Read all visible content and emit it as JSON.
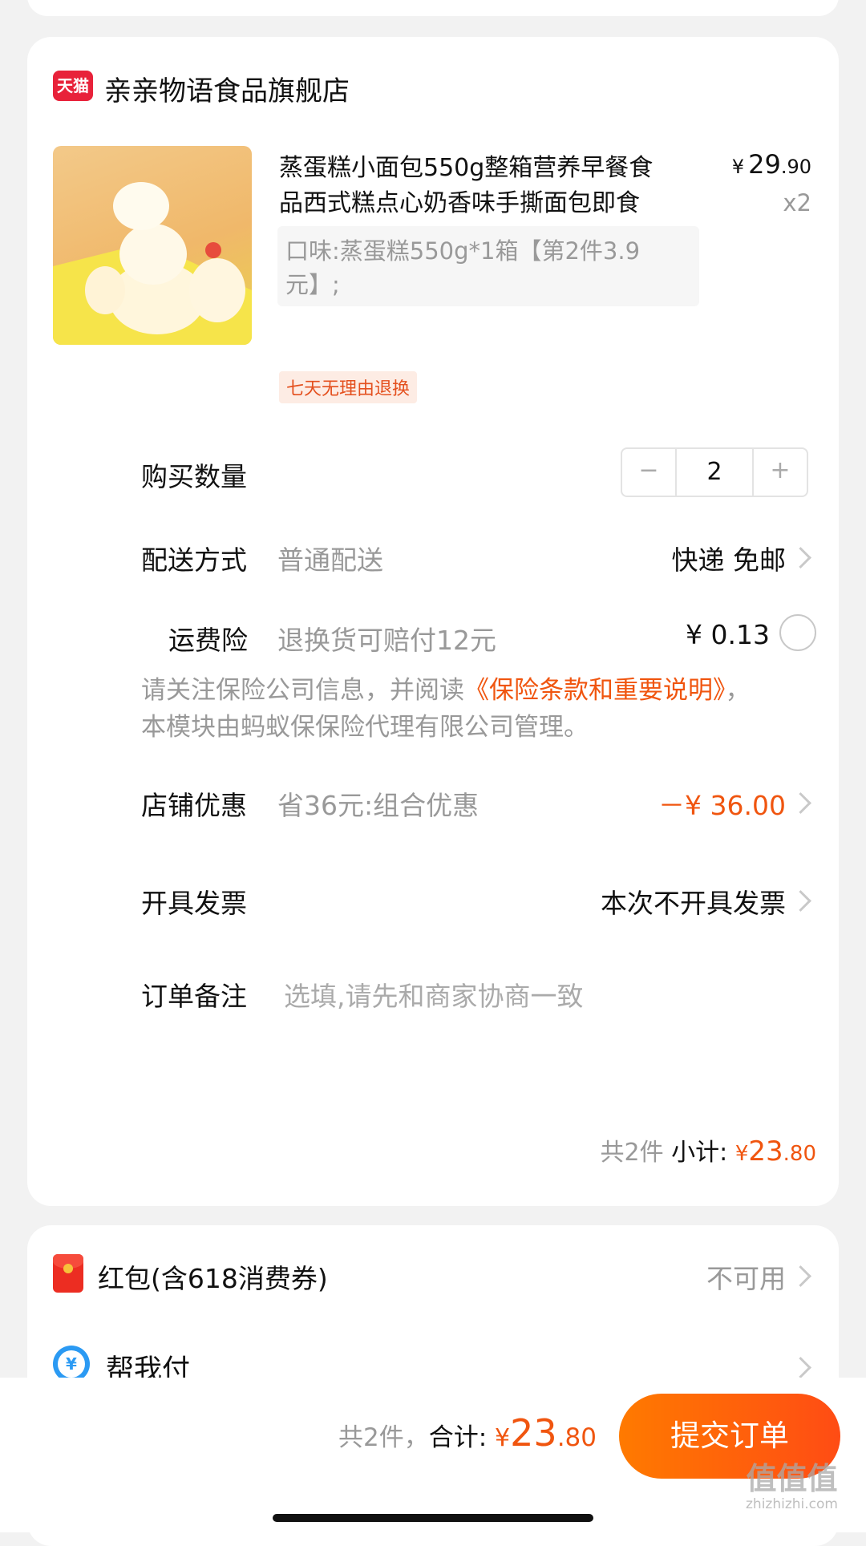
{
  "store": {
    "badge": "天猫",
    "name": "亲亲物语食品旗舰店"
  },
  "product": {
    "title_line1": "蒸蛋糕小面包550g整箱营养早餐食",
    "title_line2": "品西式糕点心奶香味手撕面包即食",
    "spec_line1": "口味:蒸蛋糕550g*1箱【第2件3.9",
    "spec_line2": "元】;",
    "price_symbol": "¥",
    "price_int": "29",
    "price_dec": ".90",
    "count": "x2",
    "tag": "七天无理由退换"
  },
  "quantity": {
    "label": "购买数量",
    "value": "2",
    "minus": "−",
    "plus": "+"
  },
  "delivery": {
    "label": "配送方式",
    "value": "普通配送",
    "right": "快递 免邮"
  },
  "insurance": {
    "label": "运费险",
    "value": "退换货可赔付12元",
    "price": "¥ 0.13",
    "note_prefix": "请关注保险公司信息，并阅读",
    "note_link": "《保险条款和重要说明》",
    "note_suffix": "，",
    "note_line2": "本模块由蚂蚁保保险代理有限公司管理。"
  },
  "discount": {
    "label": "店铺优惠",
    "value": "省36元:组合优惠",
    "amount": "－¥ 36.00"
  },
  "invoice": {
    "label": "开具发票",
    "value": "本次不开具发票"
  },
  "remark": {
    "label": "订单备注",
    "placeholder": "选填,请先和商家协商一致"
  },
  "subtotal": {
    "count": "共2件",
    "label": "小计:",
    "symbol": "¥",
    "int": "23",
    "dec": ".80"
  },
  "redpacket": {
    "label": "红包(含618消费券)",
    "value": "不可用"
  },
  "helppay": {
    "label": "帮我付"
  },
  "footer": {
    "count": "共2件，",
    "label": "合计:",
    "symbol": "¥",
    "int": "23",
    "dec": ".80",
    "submit": "提交订单"
  },
  "watermark": {
    "main": "值值值",
    "sub": "zhizhizhi.com"
  },
  "colors": {
    "accent": "#f0550f",
    "submit_start": "#ff7a00",
    "submit_end": "#ff4c14",
    "tmall_red": "#e8223a"
  }
}
